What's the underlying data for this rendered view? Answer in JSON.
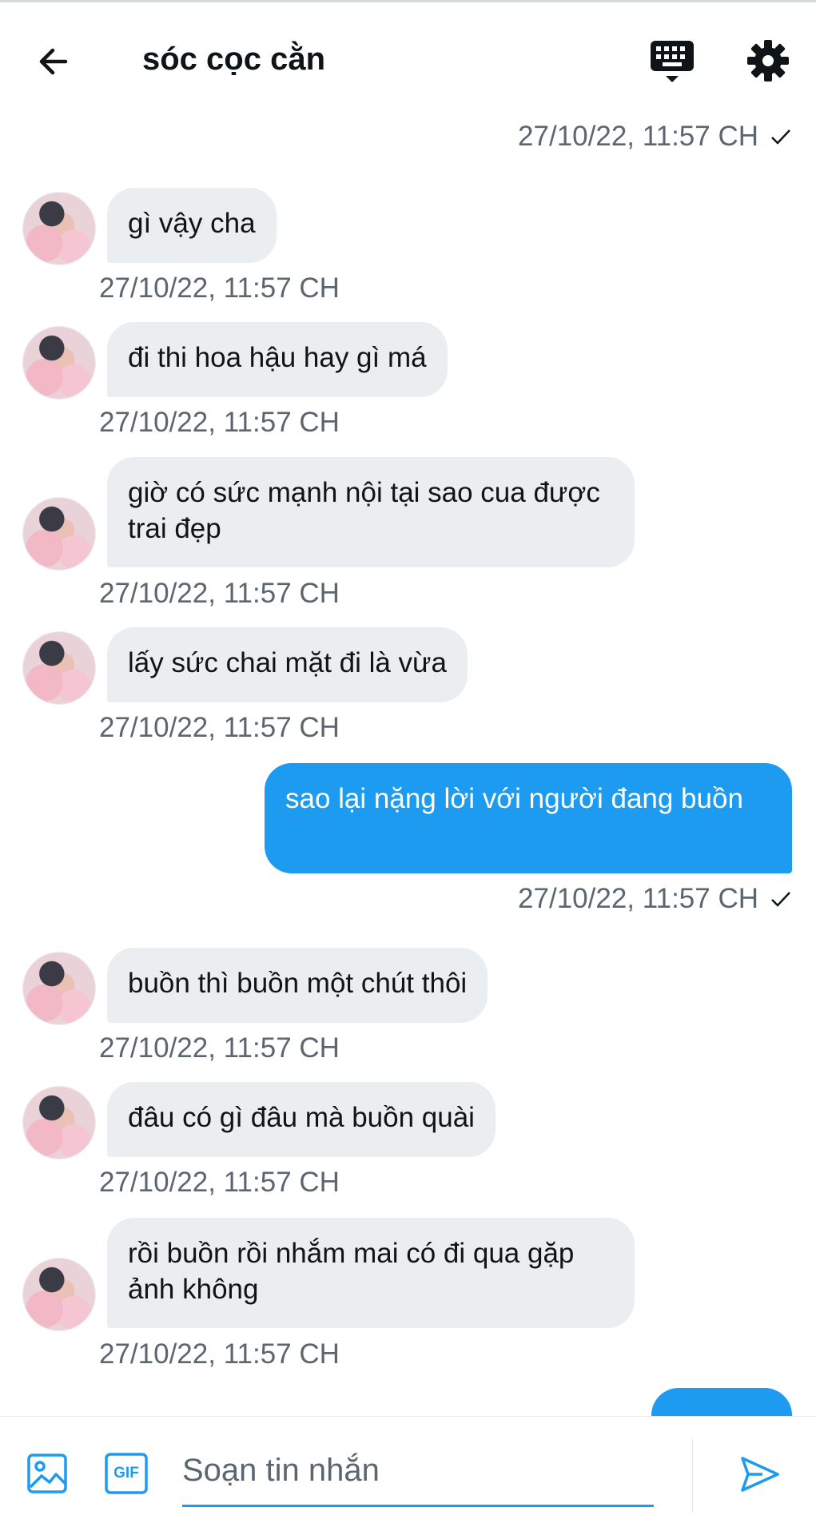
{
  "header": {
    "title": "sóc cọc cằn",
    "back_icon": "arrow-left-icon",
    "keyboard_icon": "keyboard-icon",
    "settings_icon": "gear-icon"
  },
  "colors": {
    "accent": "#1d9bf0",
    "bubble_in": "#ebeef0",
    "timestamp": "#5b6670"
  },
  "messages": [
    {
      "direction": "out",
      "text": "",
      "time": "27/10/22, 11:57 CH",
      "seen": true
    },
    {
      "direction": "in",
      "text": "gì vậy cha",
      "time": "27/10/22, 11:57 CH"
    },
    {
      "direction": "in",
      "text": "đi thi hoa hậu hay gì má",
      "time": "27/10/22, 11:57 CH"
    },
    {
      "direction": "in",
      "text": "giờ có sức mạnh nội tại sao cua được trai đẹp",
      "time": "27/10/22, 11:57 CH"
    },
    {
      "direction": "in",
      "text": "lấy sức chai mặt đi là vừa",
      "time": "27/10/22, 11:57 CH"
    },
    {
      "direction": "out",
      "text": "sao lại nặng lời với người đang buồn",
      "time": "27/10/22, 11:57 CH",
      "seen": true
    },
    {
      "direction": "in",
      "text": "buồn thì buồn một chút thôi",
      "time": "27/10/22, 11:57 CH"
    },
    {
      "direction": "in",
      "text": "đâu có gì đâu mà buồn quài",
      "time": "27/10/22, 11:57 CH"
    },
    {
      "direction": "in",
      "text": "rồi buồn rồi nhắm mai có đi qua gặp ảnh không",
      "time": "27/10/22, 11:57 CH"
    }
  ],
  "composer": {
    "placeholder": "Soạn tin nhắn",
    "media_icon": "image-icon",
    "gif_label": "GIF",
    "send_icon": "send-icon"
  }
}
